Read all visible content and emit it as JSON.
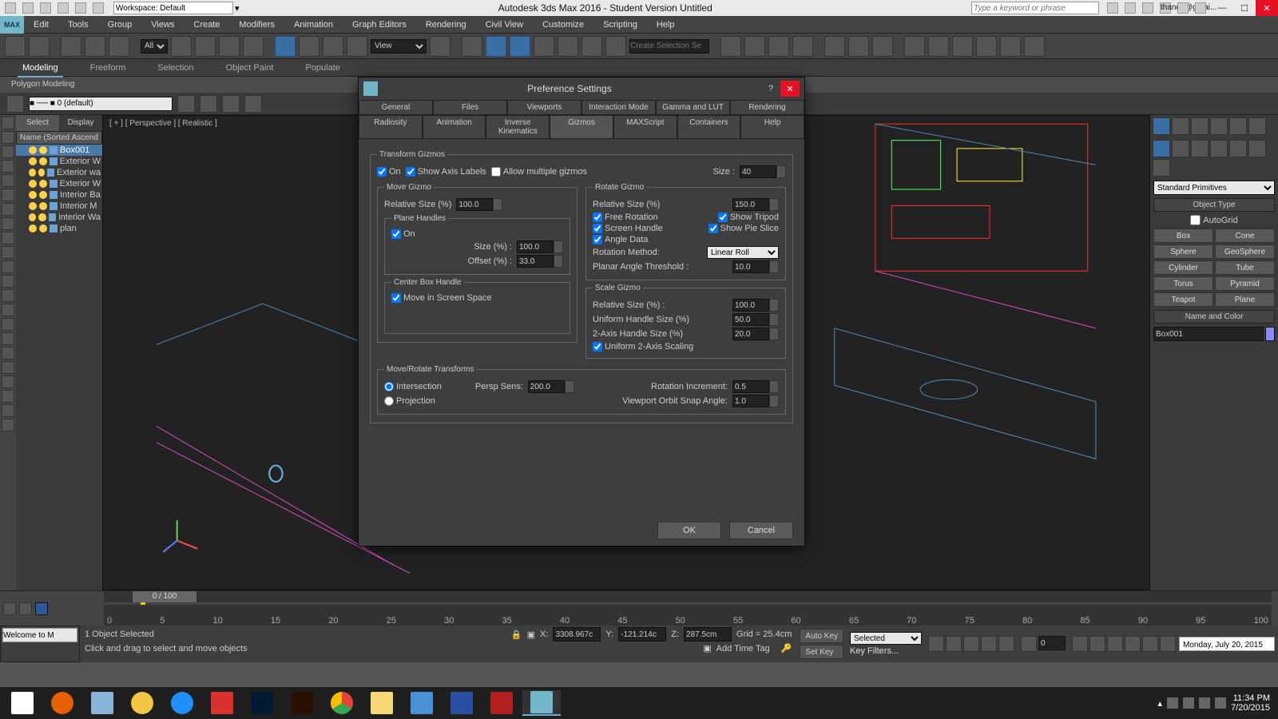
{
  "quickbar": {
    "workspace_label": "Workspace: Default",
    "app_title": "Autodesk 3ds Max 2016 - Student Version    Untitled",
    "search_placeholder": "Type a keyword or phrase",
    "user": "thandy@gmai..."
  },
  "mainmenu": [
    "Edit",
    "Tools",
    "Group",
    "Views",
    "Create",
    "Modifiers",
    "Animation",
    "Graph Editors",
    "Rendering",
    "Civil View",
    "Customize",
    "Scripting",
    "Help"
  ],
  "maintoolbar": {
    "all_selector": "All",
    "view_selector": "View",
    "selection_set_placeholder": "Create Selection Se"
  },
  "ribbon": {
    "tabs": [
      "Modeling",
      "Freeform",
      "Selection",
      "Object Paint",
      "Populate"
    ],
    "active": 0
  },
  "subbar": {
    "label": "Polygon Modeling"
  },
  "modifier_strip": {
    "selector_display": "■ ── ■ 0 (default)"
  },
  "scene": {
    "tabs": [
      "Select",
      "Display"
    ],
    "header": "Name (Sorted Ascend",
    "items": [
      {
        "label": "Box001",
        "selected": true
      },
      {
        "label": "Exterior W"
      },
      {
        "label": "Exterior wa"
      },
      {
        "label": "Exterior W"
      },
      {
        "label": "Interior Ba"
      },
      {
        "label": "Interior M"
      },
      {
        "label": "interior Wa"
      },
      {
        "label": "plan"
      }
    ]
  },
  "viewport": {
    "label": "[ + ] [ Perspective ] [ Realistic ]"
  },
  "cmd_panel": {
    "type_selector": "Standard Primitives",
    "rollout_object_type": "Object Type",
    "autogrid": "AutoGrid",
    "buttons": [
      "Box",
      "Cone",
      "Sphere",
      "GeoSphere",
      "Cylinder",
      "Tube",
      "Torus",
      "Pyramid",
      "Teapot",
      "Plane"
    ],
    "rollout_name": "Name and Color",
    "object_name": "Box001"
  },
  "timeline": {
    "slider": "0 / 100",
    "ticks": [
      "0",
      "5",
      "10",
      "15",
      "20",
      "25",
      "30",
      "35",
      "40",
      "45",
      "50",
      "55",
      "60",
      "65",
      "70",
      "75",
      "80",
      "85",
      "90",
      "95",
      "100"
    ]
  },
  "status": {
    "welcome": "Welcome to M",
    "sel_info": "1 Object Selected",
    "hint": "Click and drag to select and move objects",
    "coord_x_label": "X:",
    "coord_x": "3308.967c",
    "coord_y_label": "Y:",
    "coord_y": "-121.214c",
    "coord_z_label": "Z:",
    "coord_z": "287.5cm",
    "grid": "Grid = 25.4cm",
    "add_time_tag": "Add Time Tag",
    "auto_key": "Auto Key",
    "set_key": "Set Key",
    "key_filters": "Key Filters...",
    "key_mode_sel": "Selected",
    "frame_field": "0",
    "date": "Monday, July 20, 2015"
  },
  "taskbar": {
    "apps": [
      "start",
      "firefox",
      "calc",
      "paint",
      "ie",
      "sketchup",
      "photoshop",
      "illustrator",
      "chrome",
      "explorer",
      "media",
      "revit",
      "autocad",
      "3dsmax"
    ],
    "active": 13,
    "tray_time": "11:34 PM",
    "tray_date": "7/20/2015"
  },
  "dialog": {
    "title": "Preference Settings",
    "tabs_top": [
      "General",
      "Files",
      "Viewports",
      "Interaction Mode",
      "Gamma and LUT",
      "Rendering"
    ],
    "tabs_bottom": [
      "Radiosity",
      "Animation",
      "Inverse Kinematics",
      "Gizmos",
      "MAXScript",
      "Containers",
      "Help"
    ],
    "active_tab": "Gizmos",
    "transform_gizmos": {
      "legend": "Transform Gizmos",
      "on": "On",
      "show_axis": "Show Axis Labels",
      "allow_multiple": "Allow multiple gizmos",
      "size_label": "Size :",
      "size": "40"
    },
    "move_gizmo": {
      "legend": "Move Gizmo",
      "rel_size_label": "Relative Size (%)",
      "rel_size": "100.0",
      "plane_legend": "Plane Handles",
      "plane_on": "On",
      "plane_size_label": "Size (%) :",
      "plane_size": "100.0",
      "plane_offset_label": "Offset (%) :",
      "plane_offset": "33.0",
      "center_legend": "Center Box Handle",
      "center_move": "Move in Screen Space"
    },
    "rotate_gizmo": {
      "legend": "Rotate Gizmo",
      "rel_size_label": "Relative Size (%)",
      "rel_size": "150.0",
      "free_rotation": "Free Rotation",
      "show_tripod": "Show Tripod",
      "screen_handle": "Screen Handle",
      "show_pie": "Show Pie Slice",
      "angle_data": "Angle Data",
      "rot_method_label": "Rotation Method:",
      "rot_method": "Linear Roll",
      "planar_label": "Planar Angle Threshold :",
      "planar": "10.0"
    },
    "scale_gizmo": {
      "legend": "Scale Gizmo",
      "rel_size_label": "Relative Size (%) :",
      "rel_size": "100.0",
      "uh_label": "Uniform Handle Size (%)",
      "uh": "50.0",
      "ax2_label": "2-Axis Handle Size (%)",
      "ax2": "20.0",
      "uni2": "Uniform 2-Axis Scaling"
    },
    "move_rotate": {
      "legend": "Move/Rotate Transforms",
      "intersection": "Intersection",
      "projection": "Projection",
      "persp_label": "Persp Sens:",
      "persp": "200.0",
      "rot_inc_label": "Rotation Increment:",
      "rot_inc": "0.5",
      "orbit_label": "Viewport Orbit Snap Angle:",
      "orbit": "1.0"
    },
    "ok": "OK",
    "cancel": "Cancel"
  }
}
